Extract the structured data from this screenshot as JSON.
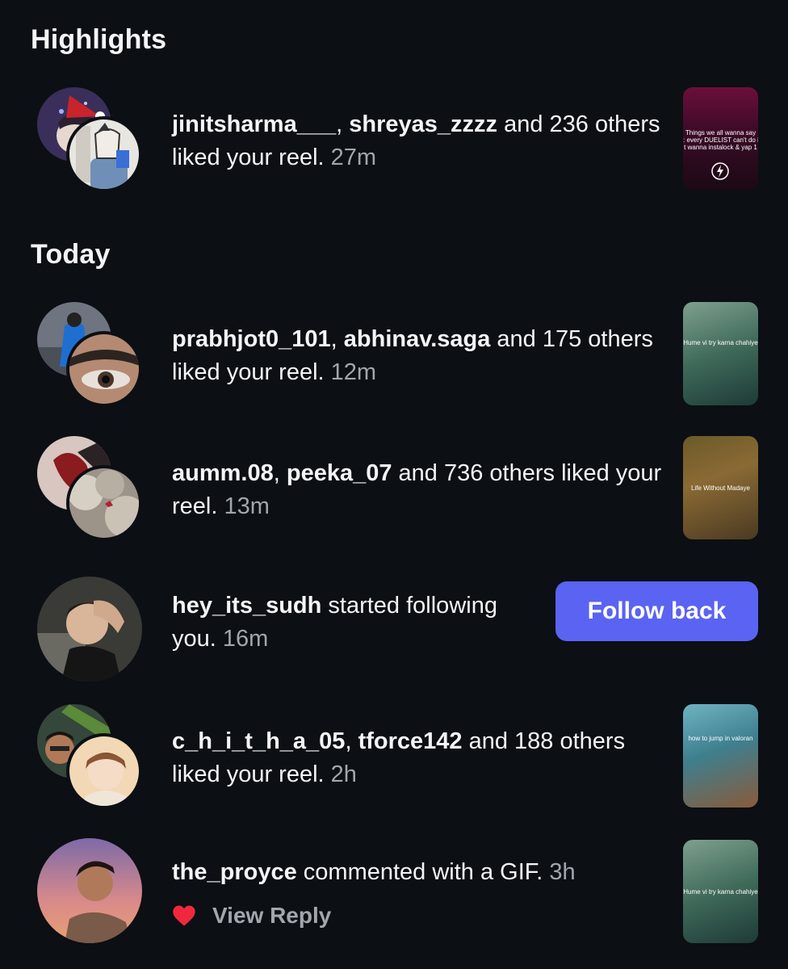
{
  "sections": {
    "highlights_title": "Highlights",
    "today_title": "Today"
  },
  "highlights": [
    {
      "user1": "jinitsharma___",
      "user2": "shreyas_zzzz",
      "rest": " and 236 others liked your reel.",
      "time": "27m",
      "thumb_caption": [
        "Things we all wanna say",
        ": every DUELIST can't do i",
        "t wanna instalock & yap 1"
      ]
    }
  ],
  "today": [
    {
      "user1": "prabhjot0_101",
      "user2": "abhinav.saga",
      "rest": " and 175 others liked your reel.",
      "time": "12m",
      "thumb_caption": "Hume vi try karna chahiye"
    },
    {
      "user1": "aumm.08",
      "user2": "peeka_07",
      "rest": " and 736 others liked your reel.",
      "time": "13m",
      "thumb_caption": "Life Without Madaye"
    },
    {
      "user1": "hey_its_sudh",
      "rest": " started following you.",
      "time": "16m",
      "button": "Follow back"
    },
    {
      "user1": "c_h_i_t_h_a_05",
      "user2": "tforce142",
      "rest": " and 188 others liked your reel.",
      "time": "2h",
      "thumb_caption": "how to jump in valoran"
    },
    {
      "user1": "the_proyce",
      "rest": " commented with a GIF.",
      "time": "3h",
      "reply_label": "View Reply",
      "thumb_caption": "Hume vi try karna chahiye"
    }
  ],
  "colors": {
    "background": "#0c0f14",
    "accent_button": "#5b63f2",
    "muted_text": "#a2a6ad",
    "heart": "#f0283e"
  }
}
